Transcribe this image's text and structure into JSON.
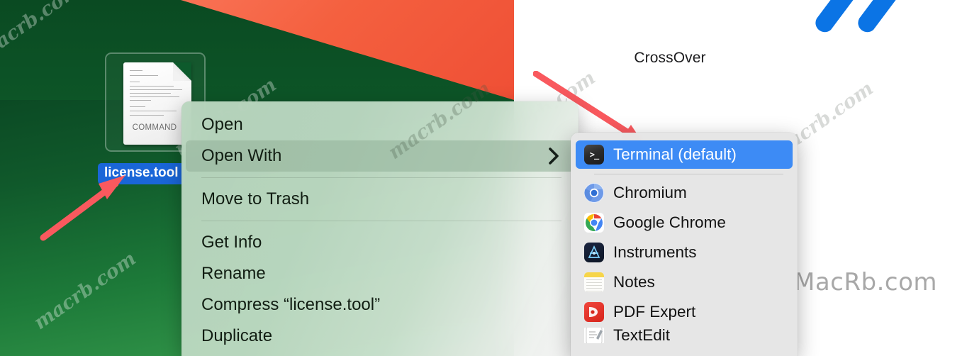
{
  "desktop": {
    "file": {
      "icon_label": "COMMAND",
      "name": "license.tool",
      "icon_name": "command-script-document-icon"
    },
    "watermarks": [
      "macrb.com",
      "macrb.com",
      "macrb.com",
      "macrb.com",
      "macrb.com",
      "macrb.com",
      "macrb.com"
    ],
    "colors": {
      "wallpaper_green": "#0d5a2c",
      "wallpaper_orange": "#f4603f",
      "selection_blue": "#1a66d8",
      "arrow_red": "#f9595e"
    }
  },
  "right_panel": {
    "app_label": "CrossOver",
    "app_logo_name": "crossover-logo",
    "brand_mark_name": "blue-double-slash-icon",
    "site_text": "MacRb.com"
  },
  "context_menu": {
    "items": [
      {
        "label": "Open",
        "name": "menu-item-open",
        "highlight": false,
        "submenu": false,
        "separator_after": false
      },
      {
        "label": "Open With",
        "name": "menu-item-open-with",
        "highlight": true,
        "submenu": true,
        "separator_after": true
      },
      {
        "label": "Move to Trash",
        "name": "menu-item-move-to-trash",
        "highlight": false,
        "submenu": false,
        "separator_after": true
      },
      {
        "label": "Get Info",
        "name": "menu-item-get-info",
        "highlight": false,
        "submenu": false,
        "separator_after": false
      },
      {
        "label": "Rename",
        "name": "menu-item-rename",
        "highlight": false,
        "submenu": false,
        "separator_after": false
      },
      {
        "label": "Compress “license.tool”",
        "name": "menu-item-compress",
        "highlight": false,
        "submenu": false,
        "separator_after": false
      },
      {
        "label": "Duplicate",
        "name": "menu-item-duplicate",
        "highlight": false,
        "submenu": false,
        "separator_after": false
      }
    ],
    "chevron_glyph": "❯"
  },
  "open_with_submenu": {
    "items": [
      {
        "label": "Terminal (default)",
        "icon": "terminal-icon",
        "name": "open-with-terminal",
        "selected": true
      },
      {
        "label": "Chromium",
        "icon": "chromium-icon",
        "name": "open-with-chromium",
        "selected": false
      },
      {
        "label": "Google Chrome",
        "icon": "chrome-icon",
        "name": "open-with-google-chrome",
        "selected": false
      },
      {
        "label": "Instruments",
        "icon": "instruments-icon",
        "name": "open-with-instruments",
        "selected": false
      },
      {
        "label": "Notes",
        "icon": "notes-icon",
        "name": "open-with-notes",
        "selected": false
      },
      {
        "label": "PDF Expert",
        "icon": "pdf-expert-icon",
        "name": "open-with-pdf-expert",
        "selected": false
      },
      {
        "label": "TextEdit",
        "icon": "textedit-icon",
        "name": "open-with-textedit",
        "selected": false
      }
    ],
    "terminal_prompt": ">_",
    "selection_color": "#3d8bf5"
  }
}
